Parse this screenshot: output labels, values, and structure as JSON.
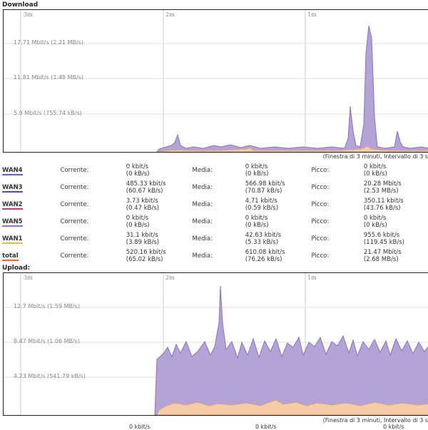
{
  "download": {
    "title": "Download",
    "time_labels": [
      "3m",
      "2m",
      "1m"
    ],
    "y_labels": [
      "17.71 Mbit/s (2.21 MB/s)",
      "11.81 Mbit/s (1.48 MB/s)",
      "5.9 Mbit/s (755.74 kB/s)"
    ],
    "footnote": "(Finestra di 3 minuti, Intervallo di 3 s"
  },
  "upload": {
    "title": "Upload:",
    "time_labels": [
      "3m",
      "2m",
      "1m"
    ],
    "y_labels": [
      "12.7 Mbit/s (1.59 MB/s)",
      "8.47 Mbit/s (1.06 MB/s)",
      "4.23 Mbit/s (541.79 kB/s)"
    ],
    "footnote": "(Finestra di 3 minuti, Intervallo di 3 s"
  },
  "labels": {
    "current": "Corrente:",
    "average": "Media:",
    "peak": "Picco:"
  },
  "interfaces": [
    {
      "name": "WAN4",
      "color": "#7b55b8",
      "cur1": "0 kbit/s",
      "cur2": "(0 kB/s)",
      "avg1": "0 kbit/s",
      "avg2": "(0 kB/s)",
      "peak1": "0 kbit/s",
      "peak2": "(0 kB/s)"
    },
    {
      "name": "WAN3",
      "color": "#4d4db0",
      "cur1": "485.33 kbit/s",
      "cur2": "(60.67 kB/s)",
      "avg1": "566.98 kbit/s",
      "avg2": "(70.87 kB/s)",
      "peak1": "20.28 Mbit/s",
      "peak2": "(2.53 MB/s)"
    },
    {
      "name": "WAN2",
      "color": "#c04070",
      "cur1": "3.73 kbit/s",
      "cur2": "(0.47 kB/s)",
      "avg1": "4.71 kbit/s",
      "avg2": "(0.59 kB/s)",
      "peak1": "350.11 kbit/s",
      "peak2": "(43.76 kB/s)"
    },
    {
      "name": "WAN5",
      "color": "#9a6fd0",
      "cur1": "0 kbit/s",
      "cur2": "(0 kB/s)",
      "avg1": "0 kbit/s",
      "avg2": "(0 kB/s)",
      "peak1": "0 kbit/s",
      "peak2": "(0 kB/s)"
    },
    {
      "name": "WAN1",
      "color": "#d8c440",
      "cur1": "31.1 kbit/s",
      "cur2": "(3.89 kB/s)",
      "avg1": "42.63 kbit/s",
      "avg2": "(5.33 kB/s)",
      "peak1": "955.6 kbit/s",
      "peak2": "(119.45 kB/s)"
    },
    {
      "name": "total",
      "color": "#e07020",
      "cur1": "520.16 kbit/s",
      "cur2": "(65.02 kB/s)",
      "avg1": "610.08 kbit/s",
      "avg2": "(76.26 kB/s)",
      "peak1": "21.47 Mbit/s",
      "peak2": "(2.68 MB/s)"
    }
  ],
  "cut_row": [
    "0 kbit/s",
    "0 kbit/s",
    "0 kbit/s"
  ],
  "colors": {
    "purple_fill": "#b3a3d6",
    "purple_line": "#8a72c0",
    "orange_fill": "#f5cba8",
    "orange_line": "#e0a070",
    "gridline": "#cccccc"
  }
}
